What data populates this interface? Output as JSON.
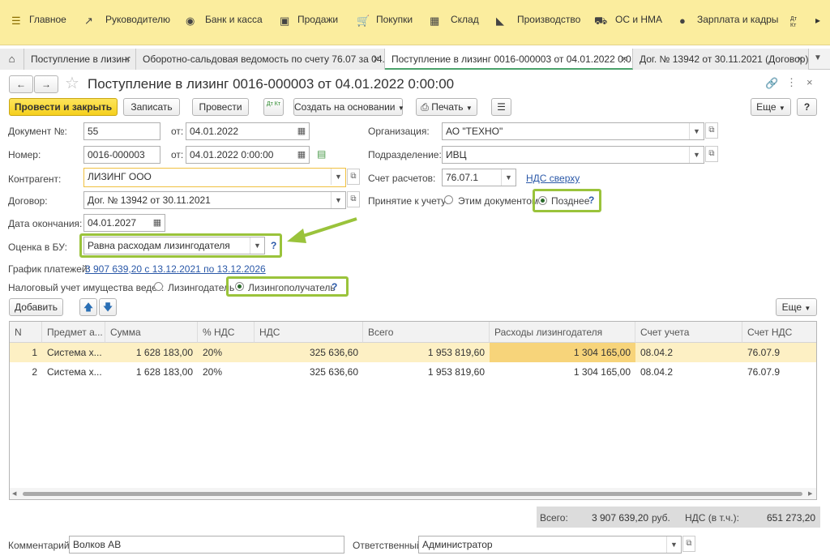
{
  "topmenu": {
    "items": [
      {
        "label": "Главное",
        "icon": "hamburger-icon"
      },
      {
        "label": "Руководителю",
        "icon": "trend-icon"
      },
      {
        "label": "Банк и касса",
        "icon": "coin-icon"
      },
      {
        "label": "Продажи",
        "icon": "bag-icon"
      },
      {
        "label": "Покупки",
        "icon": "cart-icon"
      },
      {
        "label": "Склад",
        "icon": "warehouse-icon"
      },
      {
        "label": "Производство",
        "icon": "factory-icon"
      },
      {
        "label": "ОС и НМА",
        "icon": "truck-icon"
      },
      {
        "label": "Зарплата и кадры",
        "icon": "person-icon"
      }
    ],
    "dtkt": "Дт Кт"
  },
  "tabs": [
    {
      "label": "Поступление в лизинг"
    },
    {
      "label": "Оборотно-сальдовая ведомость по счету 76.07 за 04..."
    },
    {
      "label": "Поступление в лизинг 0016-000003 от 04.01.2022 0:0..."
    },
    {
      "label": "Дог. № 13942 от 30.11.2021 (Договор)"
    }
  ],
  "doc": {
    "title": "Поступление в лизинг 0016-000003 от 04.01.2022 0:00:00"
  },
  "toolbar": {
    "post_close": "Провести и закрыть",
    "save": "Записать",
    "post": "Провести",
    "dtkt": "Дт Кт",
    "create_based": "Создать на основании",
    "print": "Печать",
    "more": "Еще",
    "help": "?"
  },
  "form": {
    "doc_no_label": "Документ №:",
    "doc_no": "55",
    "from_label": "от:",
    "doc_date": "04.01.2022",
    "number_label": "Номер:",
    "number": "0016-000003",
    "number_date": "04.01.2022  0:00:00",
    "org_label": "Организация:",
    "org": "АО \"ТЕХНО\"",
    "dept_label": "Подразделение:",
    "dept": "ИВЦ",
    "contractor_label": "Контрагент:",
    "contractor": "ЛИЗИНГ ООО",
    "account_label": "Счет расчетов:",
    "account": "76.07.1",
    "vat_link": "НДС сверху",
    "contract_label": "Договор:",
    "contract": "Дог. № 13942 от 30.11.2021",
    "accept_label": "Принятие к учету:",
    "accept_opt1": "Этим документом",
    "accept_opt2": "Позднее",
    "end_label": "Дата окончания:",
    "end_date": "04.01.2027",
    "bu_label": "Оценка в БУ:",
    "bu_value": "Равна расходам лизингодателя",
    "schedule_label": "График платежей:",
    "schedule_link": "3 907 639,20 с 13.12.2021 по 13.12.2026",
    "tax_label": "Налоговый учет имущества ведет:",
    "tax_opt1": "Лизингодатель",
    "tax_opt2": "Лизингополучатель",
    "q": "?"
  },
  "table": {
    "add": "Добавить",
    "more": "Еще",
    "headers": [
      "N",
      "Предмет а...",
      "Сумма",
      "% НДС",
      "НДС",
      "Всего",
      "Расходы лизингодателя",
      "Счет учета",
      "Счет НДС"
    ],
    "rows": [
      [
        "1",
        "Система х...",
        "1 628 183,00",
        "20%",
        "325 636,60",
        "1 953 819,60",
        "1 304 165,00",
        "08.04.2",
        "76.07.9"
      ],
      [
        "2",
        "Система х...",
        "1 628 183,00",
        "20%",
        "325 636,60",
        "1 953 819,60",
        "1 304 165,00",
        "08.04.2",
        "76.07.9"
      ]
    ]
  },
  "totals": {
    "total_label": "Всего:",
    "total": "3 907 639,20",
    "currency": "руб.",
    "vat_label": "НДС (в т.ч.):",
    "vat": "651 273,20"
  },
  "bottom": {
    "comment_label": "Комментарий:",
    "comment": "Волков АВ",
    "resp_label": "Ответственный:",
    "resp": "Администратор"
  },
  "colors": {
    "topbar": "#fbed9e",
    "accent_yellow": "#f5cf1d",
    "highlight_green": "#9ac33b",
    "selected_row": "#fdf0c4"
  }
}
